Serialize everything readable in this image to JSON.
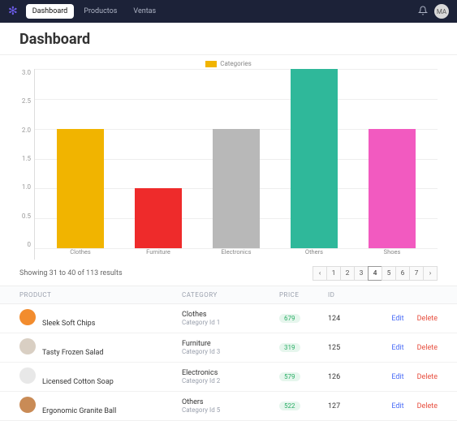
{
  "nav": {
    "items": [
      "Dashboard",
      "Productos",
      "Ventas"
    ],
    "avatar": "MA"
  },
  "page": {
    "title": "Dashboard"
  },
  "chart_data": {
    "type": "bar",
    "legend": "Categories",
    "categories": [
      "Clothes",
      "Furniture",
      "Electronics",
      "Others",
      "Shoes"
    ],
    "values": [
      2,
      1,
      2,
      3,
      2
    ],
    "colors": [
      "#f1b400",
      "#ee2b2b",
      "#b8b8b8",
      "#2fb89a",
      "#f25ac0"
    ],
    "ylim": [
      0,
      3
    ],
    "yticks": [
      "3.0",
      "2.5",
      "2.0",
      "1.5",
      "1.0",
      "0.5",
      "0"
    ]
  },
  "results": {
    "text": "Showing 31 to 40 of 113 results"
  },
  "pagination": {
    "prev": "‹",
    "next": "›",
    "pages": [
      "1",
      "2",
      "3",
      "4",
      "5",
      "6",
      "7"
    ],
    "active": "4"
  },
  "table": {
    "headers": {
      "product": "PRODUCT",
      "category": "CATEGORY",
      "price": "PRICE",
      "id": "ID"
    },
    "actions": {
      "edit": "Edit",
      "delete": "Delete"
    },
    "rows": [
      {
        "product": "Sleek Soft Chips",
        "category": "Clothes",
        "catSub": "Category Id 1",
        "price": "679",
        "id": "124",
        "thumb": "#f28c2e"
      },
      {
        "product": "Tasty Frozen Salad",
        "category": "Furniture",
        "catSub": "Category Id 3",
        "price": "319",
        "id": "125",
        "thumb": "#d9cfc3"
      },
      {
        "product": "Licensed Cotton Soap",
        "category": "Electronics",
        "catSub": "Category Id 2",
        "price": "579",
        "id": "126",
        "thumb": "#e8e8e8"
      },
      {
        "product": "Ergonomic Granite Ball",
        "category": "Others",
        "catSub": "Category Id 5",
        "price": "522",
        "id": "127",
        "thumb": "#c98b56"
      }
    ]
  }
}
